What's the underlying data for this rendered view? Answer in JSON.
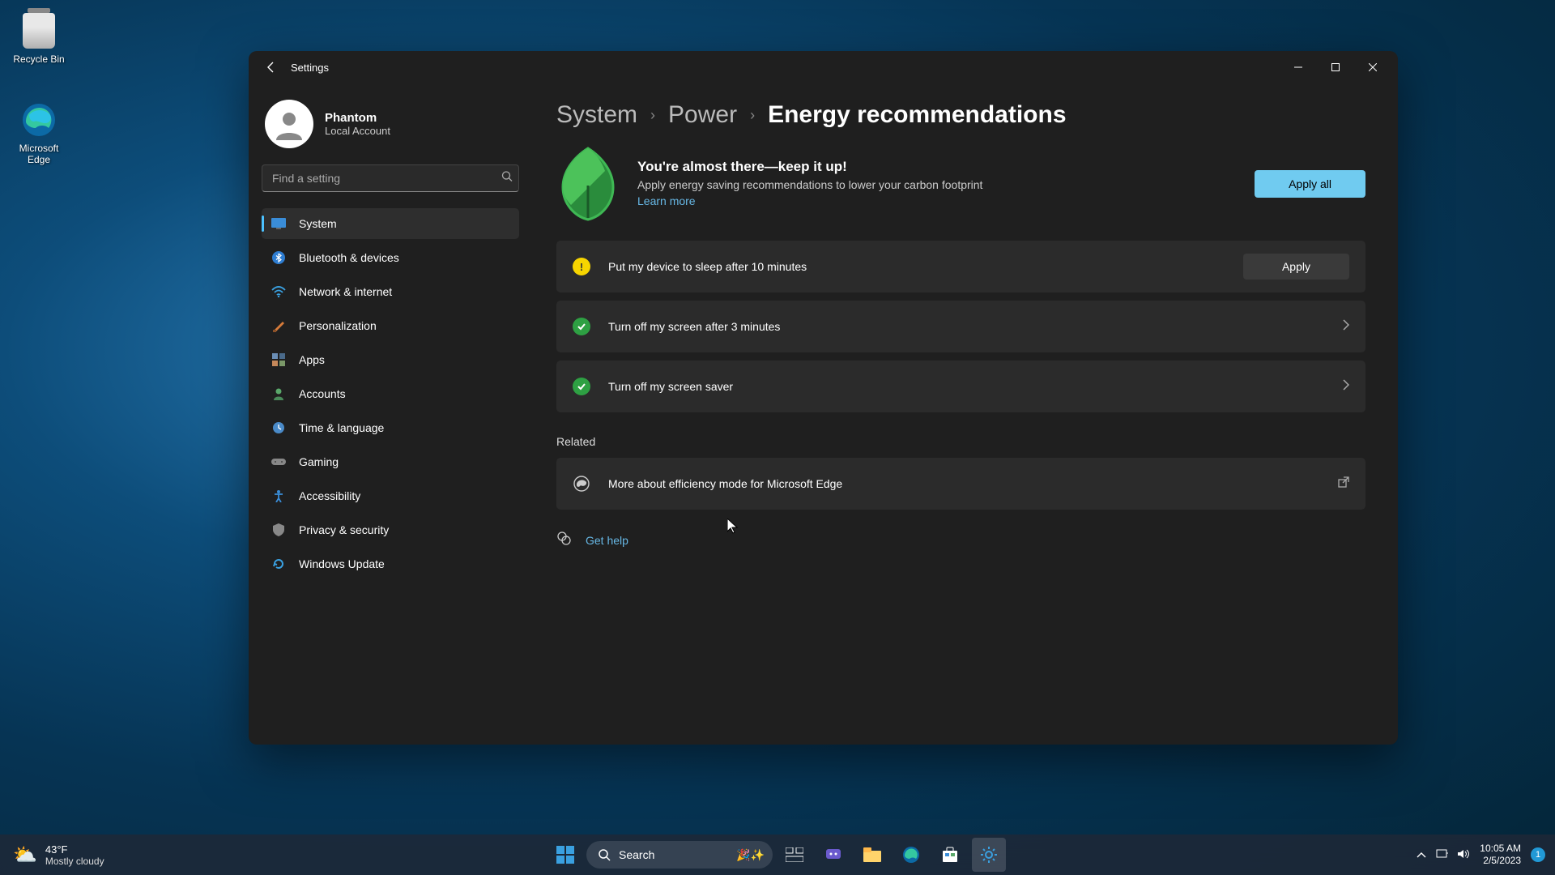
{
  "desktop": {
    "recycle_bin": "Recycle Bin",
    "edge": "Microsoft Edge"
  },
  "window": {
    "title": "Settings",
    "user": {
      "name": "Phantom",
      "sub": "Local Account"
    },
    "search_placeholder": "Find a setting",
    "nav": [
      {
        "label": "System"
      },
      {
        "label": "Bluetooth & devices"
      },
      {
        "label": "Network & internet"
      },
      {
        "label": "Personalization"
      },
      {
        "label": "Apps"
      },
      {
        "label": "Accounts"
      },
      {
        "label": "Time & language"
      },
      {
        "label": "Gaming"
      },
      {
        "label": "Accessibility"
      },
      {
        "label": "Privacy & security"
      },
      {
        "label": "Windows Update"
      }
    ],
    "breadcrumb": {
      "a": "System",
      "b": "Power",
      "c": "Energy recommendations"
    },
    "hero": {
      "title": "You're almost there—keep it up!",
      "sub": "Apply energy saving recommendations to lower your carbon footprint",
      "link": "Learn more",
      "apply_all": "Apply all"
    },
    "recs": [
      {
        "status": "warn",
        "label": "Put my device to sleep after 10 minutes",
        "action": "Apply"
      },
      {
        "status": "ok",
        "label": "Turn off my screen after 3 minutes",
        "action": "chevron"
      },
      {
        "status": "ok",
        "label": "Turn off my screen saver",
        "action": "chevron"
      }
    ],
    "related_heading": "Related",
    "related": {
      "label": "More about efficiency mode for Microsoft Edge"
    },
    "help_label": "Get help"
  },
  "taskbar": {
    "weather_temp": "43°F",
    "weather_desc": "Mostly cloudy",
    "search": "Search",
    "time": "10:05 AM",
    "date": "2/5/2023",
    "notif_count": "1"
  }
}
